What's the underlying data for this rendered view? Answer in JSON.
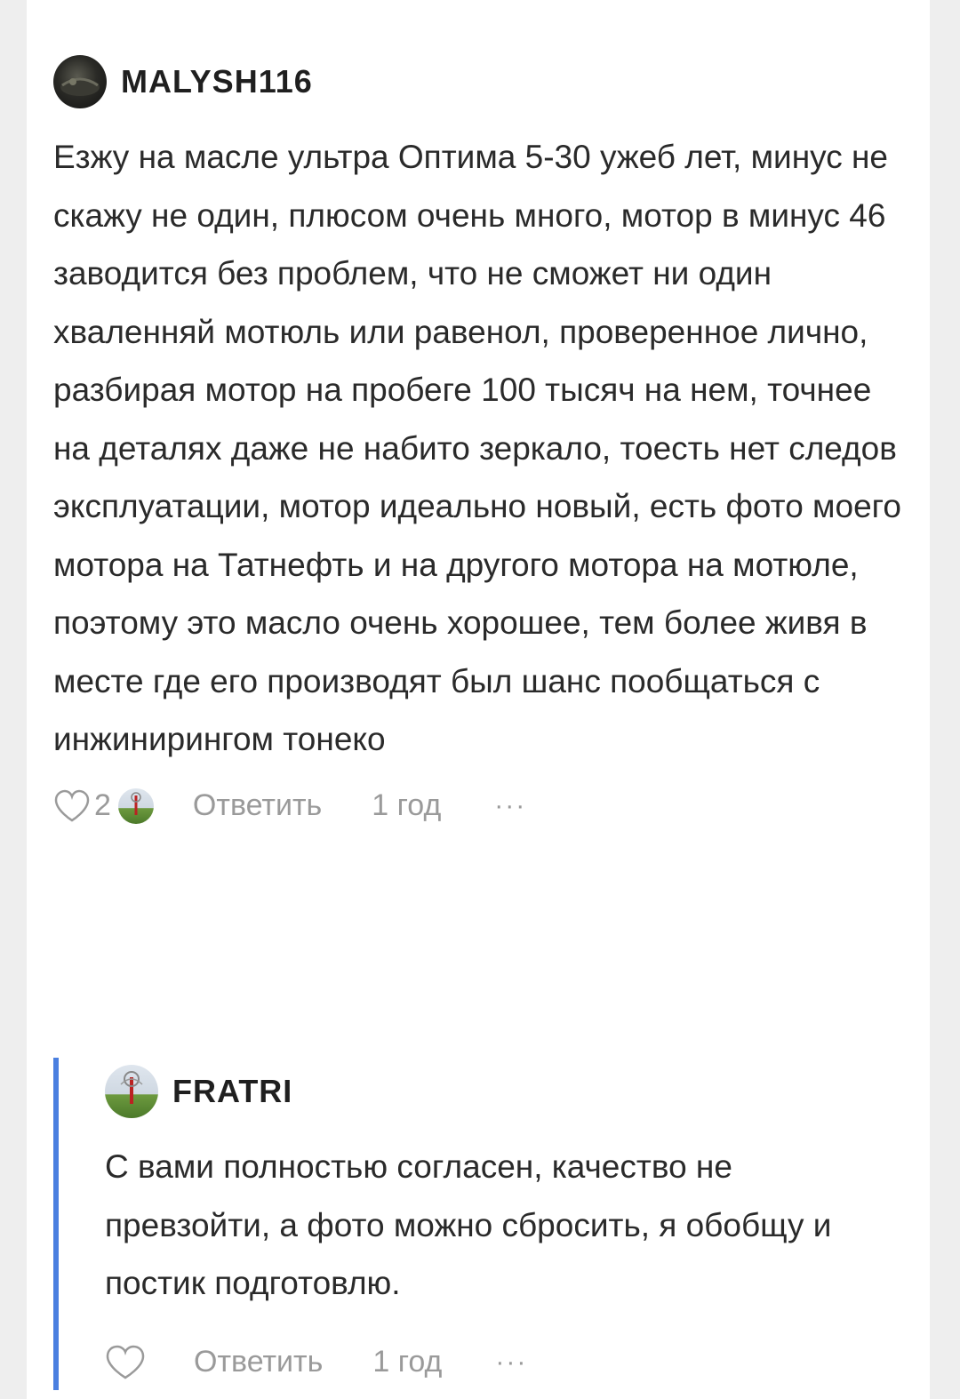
{
  "comments": [
    {
      "author": "MALYSH116",
      "text": "Езжу на масле ультра Оптима 5-30 ужеб лет, минус не скажу не один, плюсом очень много, мотор в минус 46 заводится без проблем, что не сможет ни один хваленняй мотюль или равенол, проверенное лично, разбирая мотор на пробеге 100 тысяч на нем, точнее на деталях даже не набито зеркало, тоесть нет следов эксплуатации, мотор идеально новый, есть фото моего мотора на Татнефть и на другого мотора на мотюле, поэтому это масло очень хорошее, тем более живя в месте где его производят был шанс пообщаться с инжинирингом тонеко",
      "likes": "2",
      "reply_label": "Ответить",
      "time": "1 год",
      "more": "···"
    },
    {
      "author": "FRATRI",
      "text": "С вами полностью согласен, качество не превзойти, а фото можно сбросить, я обобщу и постик подготовлю.",
      "reply_label": "Ответить",
      "time": "1 год",
      "more": "···"
    }
  ],
  "colors": {
    "thread_line": "#4a7fe0",
    "muted_text": "#9a9a9a"
  }
}
